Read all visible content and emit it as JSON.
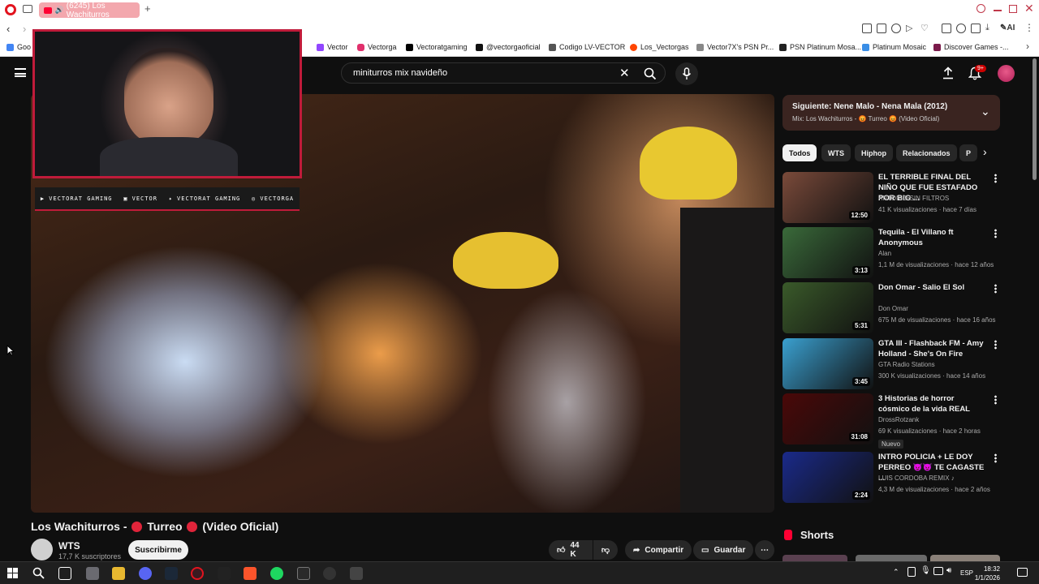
{
  "browser": {
    "tab_title": "(6245) Los Wachiturros",
    "bookmarks": [
      "Goo",
      "Vector",
      "Vectorga",
      "Vectoratgaming",
      "@vectorgaoficial",
      "Codigo LV-VECTOR",
      "Los_Vectorgas",
      "Vector7X's PSN Pr...",
      "PSN Platinum Mosa...",
      "Platinum Mosaic",
      "Discover Games -..."
    ],
    "ai_label": "AI"
  },
  "overlay": {
    "socials": [
      "VECTORAT GAMING",
      "VECTOR",
      "VECTORAT GAMING",
      "VECTORGA"
    ]
  },
  "youtube": {
    "search_value": "miniturros mix navideño",
    "notification_count": "9+",
    "video": {
      "title_part1": "Los Wachiturros - ",
      "title_part2": " Turreo ",
      "title_part3": " (Video Oficial)",
      "channel": "WTS",
      "subscribers": "17,7 K suscriptores",
      "subscribe_label": "Suscribirme",
      "likes": "44 K",
      "share_label": "Compartir",
      "save_label": "Guardar"
    },
    "next": {
      "title": "Siguiente: Nene Malo - Nena Mala (2012)",
      "subtitle": "Mix: Los Wachiturros - 😡 Turreo 😡 (Video Oficial)"
    },
    "chips": [
      "Todos",
      "WTS",
      "Hiphop",
      "Relacionados",
      "P"
    ],
    "recommendations": [
      {
        "title": "EL TERRIBLE FINAL DEL NIÑO QUE FUE ESTAFADO POR BIG ...",
        "channel": "ANTONIO SIN FILTROS",
        "meta": "41 K visualizaciones · hace 7 días",
        "duration": "12:50",
        "color": "#7a4a3a"
      },
      {
        "title": "Tequila - El Villano ft Anonymous",
        "channel": "Alan",
        "meta": "1,1 M de visualizaciones · hace 12 años",
        "duration": "3:13",
        "color": "#3a6a3a"
      },
      {
        "title": "Don Omar - Salio El Sol",
        "channel": "Don Omar",
        "meta": "675 M de visualizaciones · hace 16 años",
        "duration": "5:31",
        "color": "#3a5a2a"
      },
      {
        "title": "GTA III - Flashback FM - Amy Holland - She's On Fire",
        "channel": "GTA Radio Stations",
        "meta": "300 K visualizaciones · hace 14 años",
        "duration": "3:45",
        "color": "#3aa0d0"
      },
      {
        "title": "3 Historias de horror cósmico de la vida REAL",
        "channel": "DrossRotzank",
        "meta": "69 K visualizaciones · hace 2 horas",
        "duration": "31:08",
        "color": "#4a0808",
        "badge": "Nuevo"
      },
      {
        "title": "INTRO POLICIA + LE DOY PERREO 😈😈 TE CAGASTE ...",
        "channel": "LUIS CORDOBA REMIX ♪",
        "meta": "4,3 M de visualizaciones · hace 2 años",
        "duration": "2:24",
        "color": "#1a2a8a"
      }
    ],
    "shorts_label": "Shorts"
  },
  "taskbar": {
    "time": "18:32",
    "date": "1/1/2026",
    "lang": "ESP"
  }
}
